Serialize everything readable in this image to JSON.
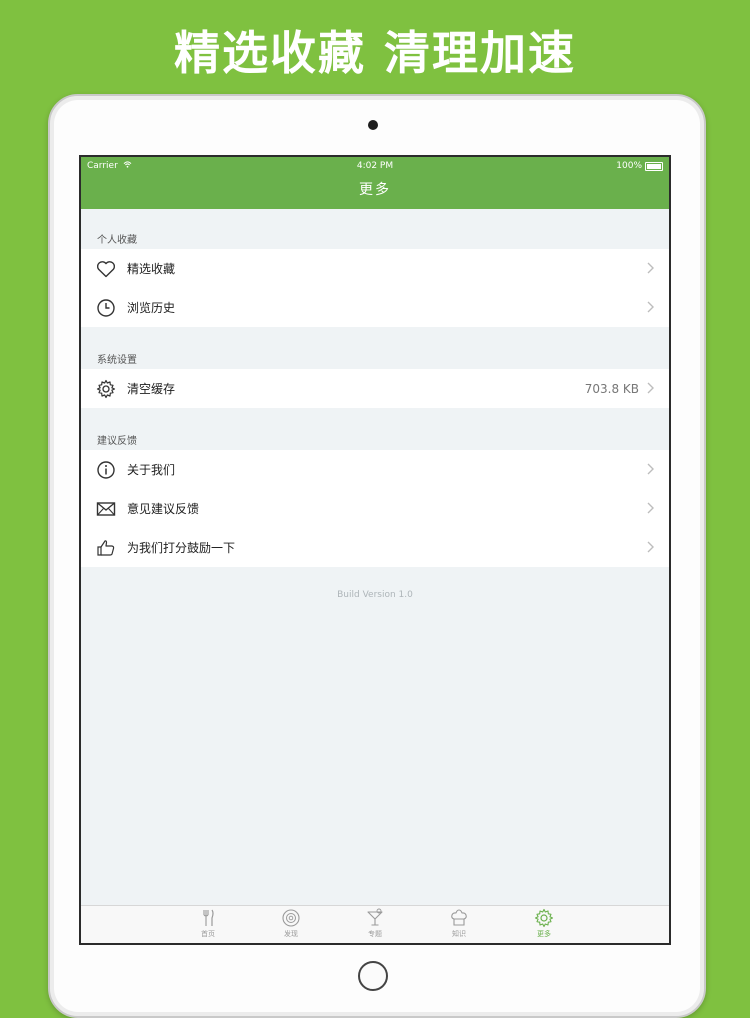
{
  "headline": "精选收藏 清理加速",
  "status_bar": {
    "carrier": "Carrier",
    "time": "4:02 PM",
    "battery": "100%"
  },
  "nav": {
    "title": "更多"
  },
  "sections": [
    {
      "header": "个人收藏",
      "items": [
        {
          "label": "精选收藏",
          "icon": "heart-icon"
        },
        {
          "label": "浏览历史",
          "icon": "clock-icon"
        }
      ]
    },
    {
      "header": "系统设置",
      "items": [
        {
          "label": "清空缓存",
          "icon": "gear-icon",
          "value": "703.8 KB"
        }
      ]
    },
    {
      "header": "建议反馈",
      "items": [
        {
          "label": "关于我们",
          "icon": "info-icon"
        },
        {
          "label": "意见建议反馈",
          "icon": "mail-icon"
        },
        {
          "label": "为我们打分鼓励一下",
          "icon": "thumbs-up-icon"
        }
      ]
    }
  ],
  "build_version": "Build Version 1.0",
  "tabs": [
    {
      "label": "首页",
      "icon": "fork-knife-icon",
      "active": false
    },
    {
      "label": "发现",
      "icon": "dish-icon",
      "active": false
    },
    {
      "label": "专题",
      "icon": "cocktail-icon",
      "active": false
    },
    {
      "label": "知识",
      "icon": "chef-hat-icon",
      "active": false
    },
    {
      "label": "更多",
      "icon": "gear-icon",
      "active": true
    }
  ],
  "colors": {
    "background": "#7fc140",
    "nav": "#6ab04c",
    "active_tab": "#6ab04c"
  }
}
